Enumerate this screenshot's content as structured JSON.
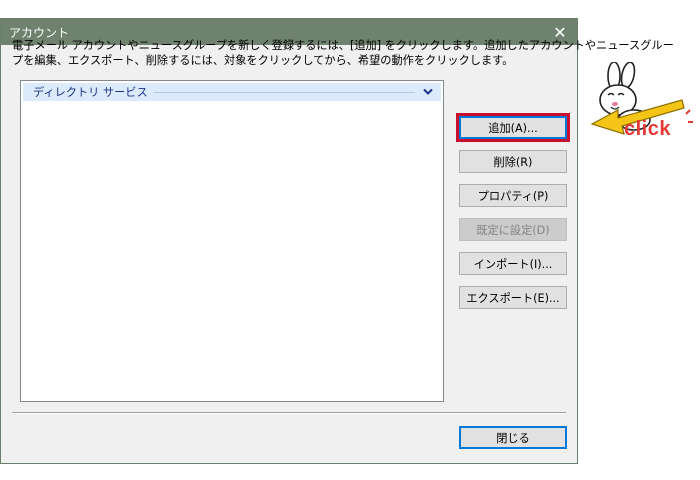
{
  "window": {
    "title": "アカウント",
    "close_glyph": "✕"
  },
  "description": {
    "line1": "電子メール アカウントやニュースグループを新しく登録するには、[追加] をクリックします。追加したアカウントやニュースグルー",
    "line2": "プを編集、エクスポート、削除するには、対象をクリックしてから、希望の動作をクリックします。"
  },
  "account_list": {
    "group_label": "ディレクトリ サービス",
    "group_icon": "chevron-down-icon"
  },
  "buttons": {
    "add": "追加(A)...",
    "remove": "削除(R)",
    "properties": "プロパティ(P)",
    "set_default": "既定に設定(D)",
    "import": "インポート(I)...",
    "export": "エクスポート(E)...",
    "close": "閉じる"
  },
  "annotation": {
    "click_label": "click"
  },
  "colors": {
    "titlebar": "#6e826e",
    "highlight": "#c8102e",
    "click_text": "#e53935",
    "arrow": "#f5c518"
  }
}
